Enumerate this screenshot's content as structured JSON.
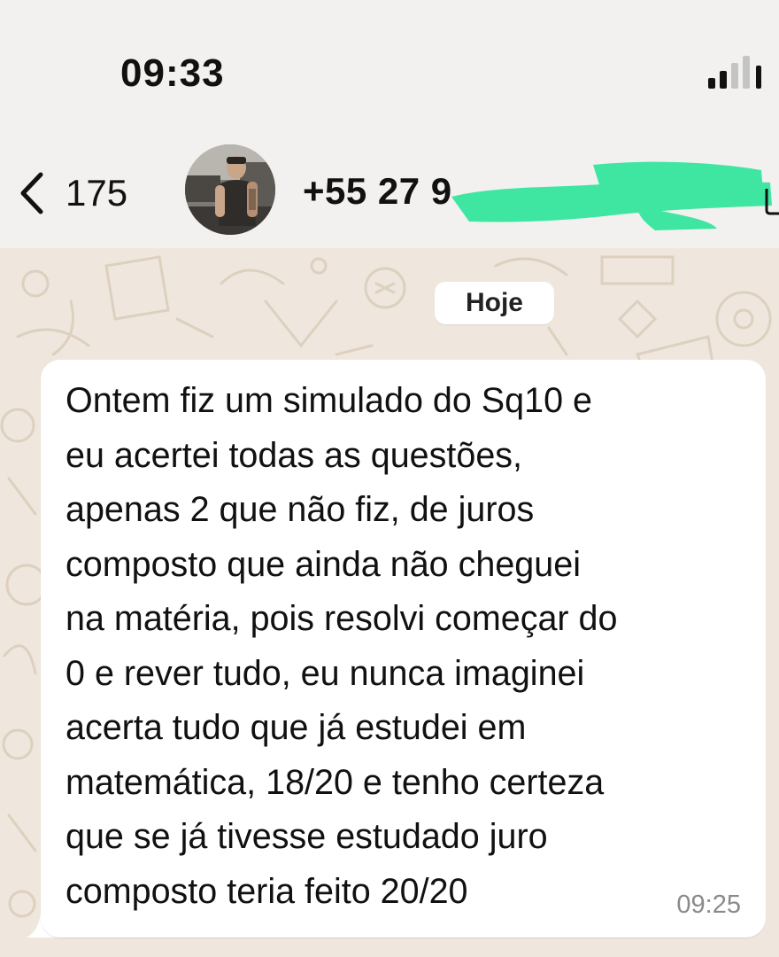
{
  "status_bar": {
    "time": "09:33"
  },
  "header": {
    "back_count": "175",
    "contact_phone": "+55 27 9"
  },
  "chat": {
    "date_label": "Hoje",
    "message": {
      "lines": [
        "Ontem fiz um simulado do Sq10 e",
        "eu acertei todas as questões,",
        "apenas 2 que não fiz, de juros",
        "composto que ainda não cheguei",
        "na matéria, pois resolvi começar do",
        "0 e rever tudo, eu nunca imaginei",
        "acerta tudo que já estudei em",
        "matemática, 18/20 e tenho certeza",
        "que se já tivesse estudado juro",
        "composto teria feito 20/20"
      ],
      "time": "09:25"
    }
  },
  "colors": {
    "header_bg": "#f2f1ef",
    "chat_bg": "#efe7dd",
    "bubble_bg": "#ffffff",
    "redaction": "#3ee6a2",
    "timestamp": "#8a8a8a"
  },
  "icons": {
    "back": "chevron-left-icon",
    "signal": "cellular-signal-icon"
  }
}
